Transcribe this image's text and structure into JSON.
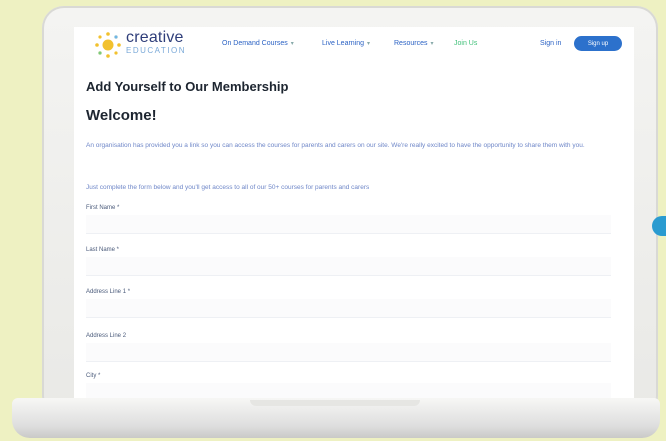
{
  "site": {
    "logo_main": "creative",
    "logo_sub": "EDUCATION",
    "nav": [
      {
        "label": "On Demand Courses"
      },
      {
        "label": "Live Learning"
      },
      {
        "label": "Resources"
      }
    ],
    "join_label": "Join Us",
    "signin_label": "Sign in",
    "signup_label": "Sign up",
    "colors": {
      "brand": "#2c71cc",
      "join": "#42c07a",
      "accent_device": "#2a9bd0"
    }
  },
  "content": {
    "title": "Add Yourself to Our Membership",
    "welcome": "Welcome!",
    "paragraph1": "An organisation has provided you a link so you can access the courses for parents and carers on our site. We're really excited to have the opportunity to share them with you.",
    "paragraph2": "Just complete the form below and you'll get access to all of our 50+ courses for parents and carers"
  },
  "form": {
    "fields": [
      {
        "label": "First Name *"
      },
      {
        "label": "Last Name *"
      },
      {
        "label": "Address Line 1 *"
      },
      {
        "label": "Address Line 2"
      },
      {
        "label": "City *"
      }
    ]
  }
}
